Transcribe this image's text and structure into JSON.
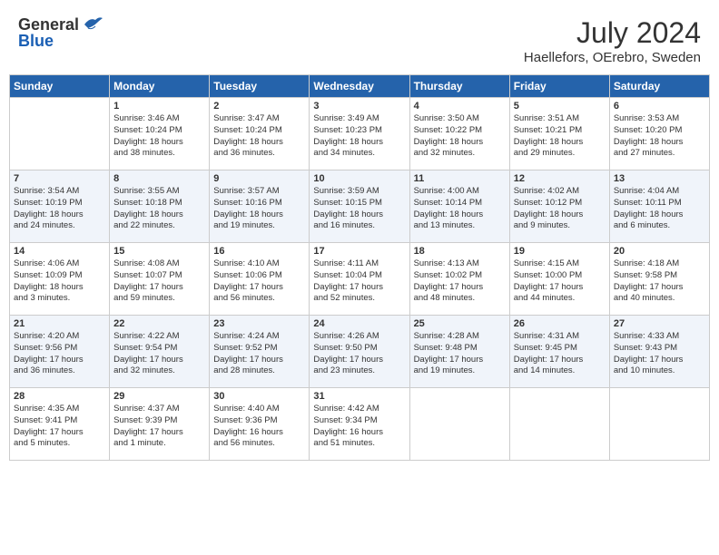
{
  "header": {
    "logo_general": "General",
    "logo_blue": "Blue",
    "month_year": "July 2024",
    "location": "Haellefors, OErebro, Sweden"
  },
  "weekdays": [
    "Sunday",
    "Monday",
    "Tuesday",
    "Wednesday",
    "Thursday",
    "Friday",
    "Saturday"
  ],
  "weeks": [
    [
      {
        "day": "",
        "content": ""
      },
      {
        "day": "1",
        "content": "Sunrise: 3:46 AM\nSunset: 10:24 PM\nDaylight: 18 hours\nand 38 minutes."
      },
      {
        "day": "2",
        "content": "Sunrise: 3:47 AM\nSunset: 10:24 PM\nDaylight: 18 hours\nand 36 minutes."
      },
      {
        "day": "3",
        "content": "Sunrise: 3:49 AM\nSunset: 10:23 PM\nDaylight: 18 hours\nand 34 minutes."
      },
      {
        "day": "4",
        "content": "Sunrise: 3:50 AM\nSunset: 10:22 PM\nDaylight: 18 hours\nand 32 minutes."
      },
      {
        "day": "5",
        "content": "Sunrise: 3:51 AM\nSunset: 10:21 PM\nDaylight: 18 hours\nand 29 minutes."
      },
      {
        "day": "6",
        "content": "Sunrise: 3:53 AM\nSunset: 10:20 PM\nDaylight: 18 hours\nand 27 minutes."
      }
    ],
    [
      {
        "day": "7",
        "content": "Sunrise: 3:54 AM\nSunset: 10:19 PM\nDaylight: 18 hours\nand 24 minutes."
      },
      {
        "day": "8",
        "content": "Sunrise: 3:55 AM\nSunset: 10:18 PM\nDaylight: 18 hours\nand 22 minutes."
      },
      {
        "day": "9",
        "content": "Sunrise: 3:57 AM\nSunset: 10:16 PM\nDaylight: 18 hours\nand 19 minutes."
      },
      {
        "day": "10",
        "content": "Sunrise: 3:59 AM\nSunset: 10:15 PM\nDaylight: 18 hours\nand 16 minutes."
      },
      {
        "day": "11",
        "content": "Sunrise: 4:00 AM\nSunset: 10:14 PM\nDaylight: 18 hours\nand 13 minutes."
      },
      {
        "day": "12",
        "content": "Sunrise: 4:02 AM\nSunset: 10:12 PM\nDaylight: 18 hours\nand 9 minutes."
      },
      {
        "day": "13",
        "content": "Sunrise: 4:04 AM\nSunset: 10:11 PM\nDaylight: 18 hours\nand 6 minutes."
      }
    ],
    [
      {
        "day": "14",
        "content": "Sunrise: 4:06 AM\nSunset: 10:09 PM\nDaylight: 18 hours\nand 3 minutes."
      },
      {
        "day": "15",
        "content": "Sunrise: 4:08 AM\nSunset: 10:07 PM\nDaylight: 17 hours\nand 59 minutes."
      },
      {
        "day": "16",
        "content": "Sunrise: 4:10 AM\nSunset: 10:06 PM\nDaylight: 17 hours\nand 56 minutes."
      },
      {
        "day": "17",
        "content": "Sunrise: 4:11 AM\nSunset: 10:04 PM\nDaylight: 17 hours\nand 52 minutes."
      },
      {
        "day": "18",
        "content": "Sunrise: 4:13 AM\nSunset: 10:02 PM\nDaylight: 17 hours\nand 48 minutes."
      },
      {
        "day": "19",
        "content": "Sunrise: 4:15 AM\nSunset: 10:00 PM\nDaylight: 17 hours\nand 44 minutes."
      },
      {
        "day": "20",
        "content": "Sunrise: 4:18 AM\nSunset: 9:58 PM\nDaylight: 17 hours\nand 40 minutes."
      }
    ],
    [
      {
        "day": "21",
        "content": "Sunrise: 4:20 AM\nSunset: 9:56 PM\nDaylight: 17 hours\nand 36 minutes."
      },
      {
        "day": "22",
        "content": "Sunrise: 4:22 AM\nSunset: 9:54 PM\nDaylight: 17 hours\nand 32 minutes."
      },
      {
        "day": "23",
        "content": "Sunrise: 4:24 AM\nSunset: 9:52 PM\nDaylight: 17 hours\nand 28 minutes."
      },
      {
        "day": "24",
        "content": "Sunrise: 4:26 AM\nSunset: 9:50 PM\nDaylight: 17 hours\nand 23 minutes."
      },
      {
        "day": "25",
        "content": "Sunrise: 4:28 AM\nSunset: 9:48 PM\nDaylight: 17 hours\nand 19 minutes."
      },
      {
        "day": "26",
        "content": "Sunrise: 4:31 AM\nSunset: 9:45 PM\nDaylight: 17 hours\nand 14 minutes."
      },
      {
        "day": "27",
        "content": "Sunrise: 4:33 AM\nSunset: 9:43 PM\nDaylight: 17 hours\nand 10 minutes."
      }
    ],
    [
      {
        "day": "28",
        "content": "Sunrise: 4:35 AM\nSunset: 9:41 PM\nDaylight: 17 hours\nand 5 minutes."
      },
      {
        "day": "29",
        "content": "Sunrise: 4:37 AM\nSunset: 9:39 PM\nDaylight: 17 hours\nand 1 minute."
      },
      {
        "day": "30",
        "content": "Sunrise: 4:40 AM\nSunset: 9:36 PM\nDaylight: 16 hours\nand 56 minutes."
      },
      {
        "day": "31",
        "content": "Sunrise: 4:42 AM\nSunset: 9:34 PM\nDaylight: 16 hours\nand 51 minutes."
      },
      {
        "day": "",
        "content": ""
      },
      {
        "day": "",
        "content": ""
      },
      {
        "day": "",
        "content": ""
      }
    ]
  ]
}
